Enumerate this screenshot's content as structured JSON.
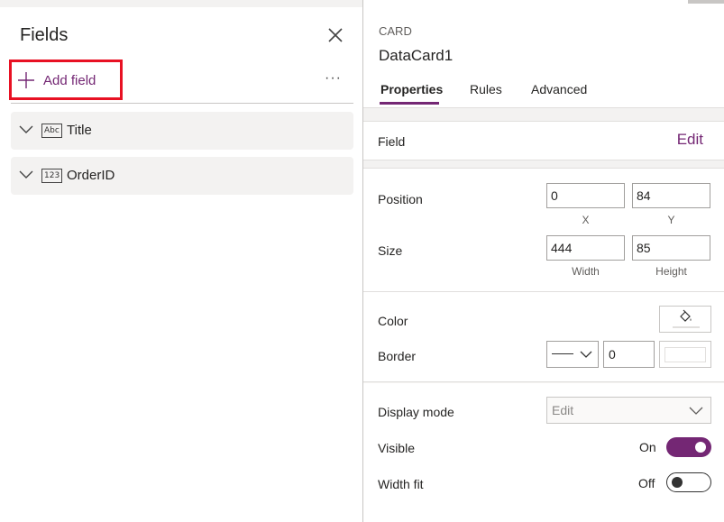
{
  "fields_pane": {
    "title": "Fields",
    "add_field_label": "Add field",
    "more_label": "···",
    "fields": [
      {
        "type_icon": "Abc",
        "name": "Title"
      },
      {
        "type_icon": "123",
        "name": "OrderID"
      }
    ]
  },
  "properties_pane": {
    "card_kind": "CARD",
    "card_name": "DataCard1",
    "tabs": [
      {
        "label": "Properties",
        "active": true
      },
      {
        "label": "Rules",
        "active": false
      },
      {
        "label": "Advanced",
        "active": false
      }
    ],
    "field": {
      "label": "Field",
      "edit_label": "Edit"
    },
    "position": {
      "label": "Position",
      "x": "0",
      "y": "84",
      "x_label": "X",
      "y_label": "Y"
    },
    "size": {
      "label": "Size",
      "width": "444",
      "height": "85",
      "width_label": "Width",
      "height_label": "Height"
    },
    "color": {
      "label": "Color",
      "icon": "paint-bucket-icon"
    },
    "border": {
      "label": "Border",
      "width": "0"
    },
    "display_mode": {
      "label": "Display mode",
      "value": "Edit"
    },
    "visible": {
      "label": "Visible",
      "state": "On"
    },
    "width_fit": {
      "label": "Width fit",
      "state": "Off"
    }
  },
  "colors": {
    "accent": "#742774",
    "highlight_box": "#e81123",
    "pane_bg": "#f3f2f1"
  }
}
